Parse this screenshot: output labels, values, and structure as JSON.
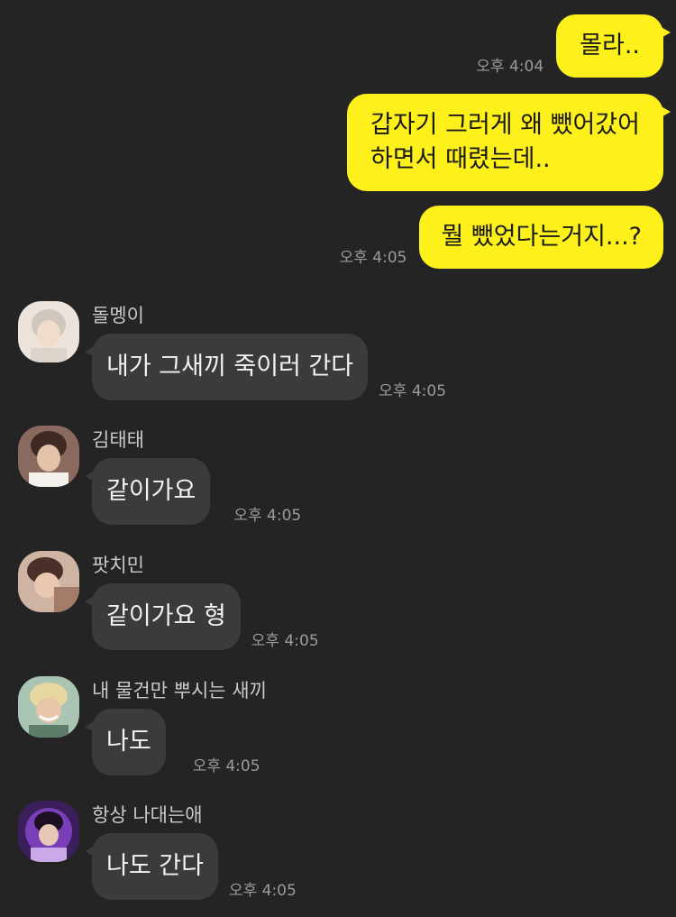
{
  "outgoing": [
    {
      "text": "몰라..",
      "time": "오후 4:04"
    },
    {
      "lines": [
        "갑자기 그러게 왜 뺐어갔어",
        "하면서 때렸는데.."
      ]
    },
    {
      "text": "뭘 뺐었다는거지...?",
      "time": "오후 4:05"
    }
  ],
  "incoming": [
    {
      "sender": "돌멩이",
      "text": "내가 그새끼 죽이러 간다",
      "time": "오후 4:05",
      "avatar_color": "#d9c9bd"
    },
    {
      "sender": "김태태",
      "text": "같이가요",
      "time": "오후 4:05",
      "avatar_color": "#6d4b3e"
    },
    {
      "sender": "팟치민",
      "text": "같이가요 형",
      "time": "오후 4:05",
      "avatar_color": "#b58a76"
    },
    {
      "sender": "내 물건만 뿌시는 새끼",
      "text": "나도",
      "time": "오후 4:05",
      "avatar_color": "#8fb09a"
    },
    {
      "sender": "항상 나대는애",
      "text": "나도 간다",
      "time": "오후 4:05",
      "avatar_color": "#5a2f8a"
    }
  ],
  "colors": {
    "background": "#242424",
    "bubble_out": "#fef01b",
    "bubble_in": "#3b3b3b",
    "time_text": "#9b9b9b",
    "sender_text": "#c9c9c9"
  }
}
